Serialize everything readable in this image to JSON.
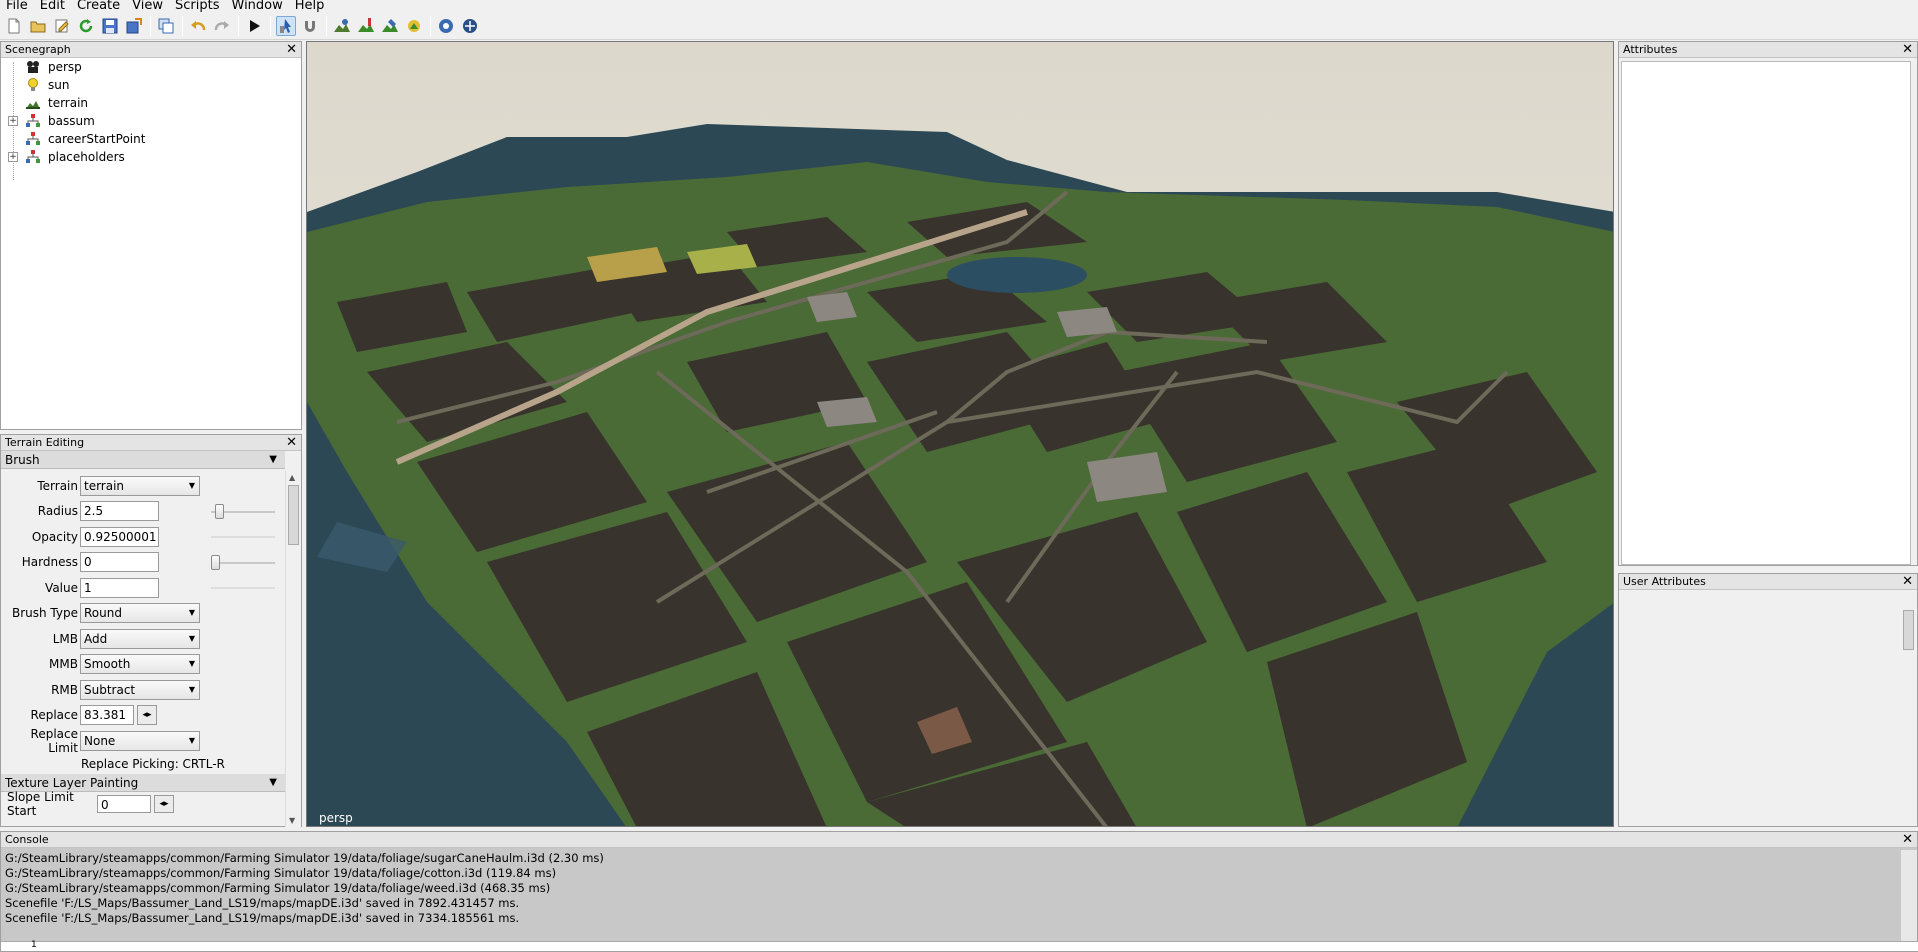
{
  "menu": [
    "File",
    "Edit",
    "Create",
    "View",
    "Scripts",
    "Window",
    "Help"
  ],
  "toolbar": {
    "buttons": [
      "new-file-icon",
      "open-folder-icon",
      "edit-icon",
      "refresh-icon",
      "save-icon",
      "export-icon",
      "clone-icon",
      "undo-icon",
      "redo-icon",
      "play-icon",
      "select-tool-icon",
      "magnet-icon",
      "terrain-sculpt-icon",
      "terrain-paint-icon",
      "foliage-paint-icon",
      "grass-paint-icon",
      "settings-globe-icon",
      "network-icon"
    ]
  },
  "scenegraph": {
    "title": "Scenegraph",
    "items": [
      {
        "label": "persp",
        "icon": "camera-icon",
        "expandable": false
      },
      {
        "label": "sun",
        "icon": "light-bulb-icon",
        "expandable": false
      },
      {
        "label": "terrain",
        "icon": "terrain-icon",
        "expandable": false
      },
      {
        "label": "bassum",
        "icon": "transform-group-icon",
        "expandable": true
      },
      {
        "label": "careerStartPoint",
        "icon": "transform-group-icon",
        "expandable": false
      },
      {
        "label": "placeholders",
        "icon": "transform-group-icon",
        "expandable": true
      }
    ]
  },
  "terrain_editing": {
    "title": "Terrain Editing",
    "brush_section": "Brush",
    "terrain_label": "Terrain",
    "terrain_value": "terrain",
    "radius_label": "Radius",
    "radius_value": "2.5",
    "radius_slider": 0.08,
    "opacity_label": "Opacity",
    "opacity_value": "0.92500001",
    "hardness_label": "Hardness",
    "hardness_value": "0",
    "hardness_slider": 0.0,
    "value_label": "Value",
    "value_value": "1",
    "brush_type_label": "Brush Type",
    "brush_type_value": "Round",
    "lmb_label": "LMB",
    "lmb_value": "Add",
    "mmb_label": "MMB",
    "mmb_value": "Smooth",
    "rmb_label": "RMB",
    "rmb_value": "Subtract",
    "replace_label": "Replace",
    "replace_value": "83.381",
    "replace_limit_label": "Replace Limit",
    "replace_limit_value": "None",
    "replace_picking_hint": "Replace Picking: CRTL-R",
    "texture_section": "Texture Layer Painting",
    "slope_limit_label": "Slope Limit Start",
    "slope_limit_value": "0"
  },
  "viewport": {
    "camera_label": "persp"
  },
  "attributes": {
    "title": "Attributes"
  },
  "user_attributes": {
    "title": "User Attributes"
  },
  "console": {
    "title": "Console",
    "lines": [
      "G:/SteamLibrary/steamapps/common/Farming Simulator 19/data/foliage/sugarCaneHaulm.i3d (2.30 ms)",
      "G:/SteamLibrary/steamapps/common/Farming Simulator 19/data/foliage/cotton.i3d (119.84 ms)",
      "G:/SteamLibrary/steamapps/common/Farming Simulator 19/data/foliage/weed.i3d (468.35 ms)",
      "Scenefile 'F:/LS_Maps/Bassumer_Land_LS19/maps/mapDE.i3d' saved in 7892.431457 ms.",
      "Scenefile 'F:/LS_Maps/Bassumer_Land_LS19/maps/mapDE.i3d' saved in 7334.185561 ms."
    ],
    "input_line_number": "1"
  },
  "colors": {
    "water": "#2d4a58",
    "grass": "#4a6a36",
    "field": "#38332c",
    "road": "#6d6a5a",
    "sky": "#e6e2d8"
  }
}
